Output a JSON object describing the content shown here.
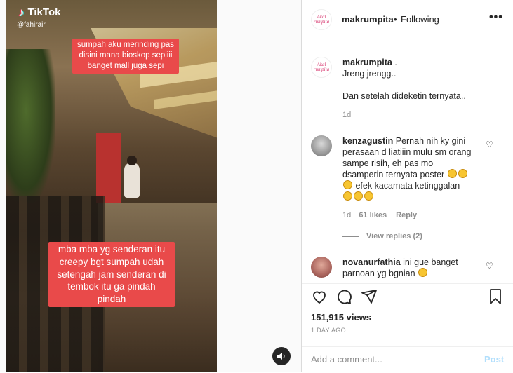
{
  "video": {
    "tiktok_logo": "TikTok",
    "tiktok_handle": "@fahirair",
    "caption_top": "sumpah aku merinding pas disini mana bioskop sepiiii banget mall juga sepi",
    "caption_bottom": "mba mba yg senderan itu creepy bgt sumpah udah setengah jam senderan di tembok itu ga pindah pindah",
    "sound_icon": "speaker-icon"
  },
  "header": {
    "avatar_text": "Akal rumpita",
    "username": "makrumpita",
    "separator": "•",
    "follow_status": "Following",
    "more_icon": "•••"
  },
  "caption_post": {
    "username": "makrumpita",
    "line1": ".",
    "line2": "Jreng jrengg..",
    "line3": "Dan setelah dideketin ternyata..",
    "time": "1d"
  },
  "comments": [
    {
      "username": "kenzagustin",
      "text_a": "Pernah nih ky gini",
      "text_b": "perasaan d liatiiin mulu sm orang",
      "text_c": "sampe risih, eh pas mo",
      "text_d": "dsamperin ternyata poster",
      "text_e": "efek kacamata ketinggalan",
      "time": "1d",
      "likes": "61 likes",
      "reply": "Reply",
      "view_replies": "View replies (2)"
    },
    {
      "username": "novanurfathia",
      "text_a": "ini gue banget",
      "text_b": "parnoan yg bgnian"
    }
  ],
  "actions": {
    "views": "151,915 views",
    "posted": "1 DAY AGO"
  },
  "add_comment": {
    "placeholder": "Add a comment...",
    "post_label": "Post"
  }
}
